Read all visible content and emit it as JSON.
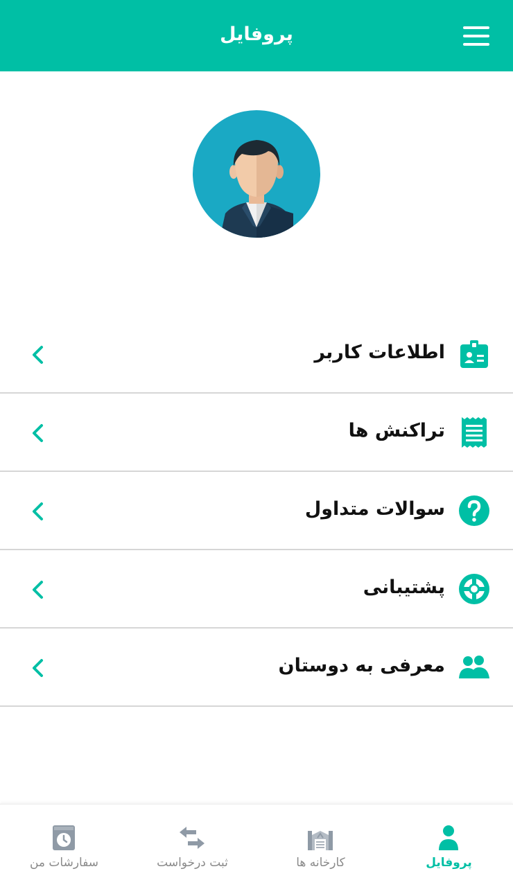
{
  "header": {
    "title": "پروفایل"
  },
  "menu": {
    "items": [
      {
        "label": "اطلاعات کاربر",
        "icon": "id-card-icon"
      },
      {
        "label": "تراکنش ها",
        "icon": "receipt-icon"
      },
      {
        "label": "سوالات متداول",
        "icon": "question-circle-icon"
      },
      {
        "label": "پشتیبانی",
        "icon": "lifebuoy-icon"
      },
      {
        "label": "معرفی به دوستان",
        "icon": "users-icon"
      }
    ]
  },
  "bottom_nav": {
    "items": [
      {
        "label": "پروفایل",
        "icon": "person-icon",
        "active": true
      },
      {
        "label": "کارخانه ها",
        "icon": "factory-icon",
        "active": false
      },
      {
        "label": "ثبت درخواست",
        "icon": "swap-arrows-icon",
        "active": false
      },
      {
        "label": "سفارشات من",
        "icon": "order-clock-icon",
        "active": false
      }
    ]
  },
  "colors": {
    "accent": "#00bfa5",
    "text": "#111111",
    "nav_inactive": "#8a8a8a",
    "divider": "#d6d6d6"
  }
}
